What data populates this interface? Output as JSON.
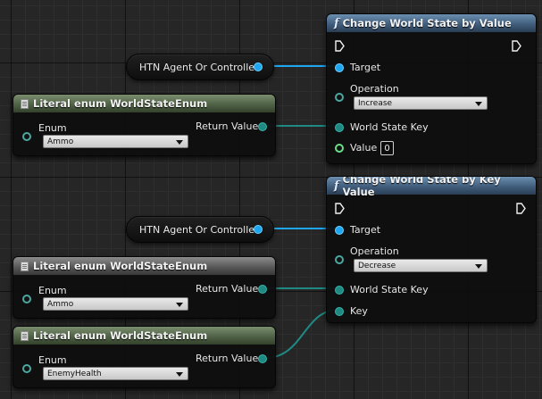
{
  "getter_nodes": [
    {
      "label": "HTN Agent Or Controller"
    },
    {
      "label": "HTN Agent Or Controller"
    }
  ],
  "literal_nodes": [
    {
      "title": "Literal enum WorldStateEnum",
      "enum_label": "Enum",
      "enum_value": "Ammo",
      "output_label": "Return Value"
    },
    {
      "title": "Literal enum WorldStateEnum",
      "enum_label": "Enum",
      "enum_value": "Ammo",
      "output_label": "Return Value"
    },
    {
      "title": "Literal enum WorldStateEnum",
      "enum_label": "Enum",
      "enum_value": "EnemyHealth",
      "output_label": "Return Value"
    }
  ],
  "func_nodes": [
    {
      "title": "Change World State by Value",
      "icon": "f",
      "target_label": "Target",
      "operation_label": "Operation",
      "operation_value": "Increase",
      "key_label": "World State Key",
      "value_label": "Value",
      "value": "0"
    },
    {
      "title": "Change World State by Key Value",
      "icon": "f",
      "target_label": "Target",
      "operation_label": "Operation",
      "operation_value": "Decrease",
      "key_label": "World State Key",
      "second_key_label": "Key"
    }
  ],
  "colors": {
    "object_pin": "#1ea7f0",
    "enum_pin": "#1f8a84",
    "function_header": "#4a6a8a",
    "literal_header": "#55694a"
  }
}
